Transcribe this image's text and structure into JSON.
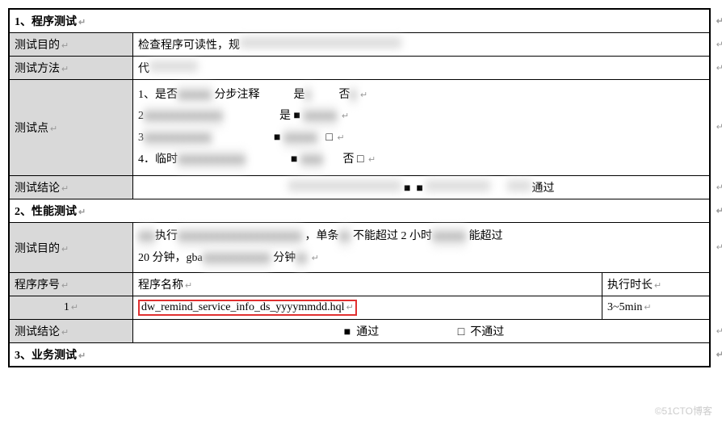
{
  "sections": {
    "s1": {
      "title": "1、程序测试"
    },
    "s2": {
      "title": "2、性能测试"
    },
    "s3": {
      "title": "3、业务测试"
    }
  },
  "row_labels": {
    "purpose": "测试目的",
    "method": "测试方法",
    "points": "测试点",
    "conclusion": "测试结论",
    "prog_seq": "程序序号",
    "prog_name": "程序名称",
    "exec_time": "执行时长"
  },
  "s1": {
    "purpose": "检查程序可读性，规",
    "method": "代",
    "points": {
      "p1_a": "1、是否",
      "p1_b": "分步注释",
      "p1_yes": "是",
      "p1_no": "否",
      "p2_a": "2",
      "p2_yes": "是",
      "p3_a": "3",
      "p4_a": "4．临时",
      "p4_no": "否"
    },
    "conclusion_pass": "通过"
  },
  "s2": {
    "purpose_a": "执行",
    "purpose_b": "，单条",
    "purpose_c": "不能超过 2 小时",
    "purpose_d": "能超过",
    "purpose_line2_a": "20 分钟，gba",
    "purpose_line2_b": "分钟",
    "program": {
      "seq": "1",
      "name": "dw_remind_service_info_ds_yyyymmdd.hql",
      "duration": "3~5min"
    },
    "conclusion": {
      "pass_label": "通过",
      "fail_label": "不通过"
    }
  },
  "checkbox": {
    "filled": "■",
    "empty": "□"
  },
  "watermark": "©51CTO博客"
}
